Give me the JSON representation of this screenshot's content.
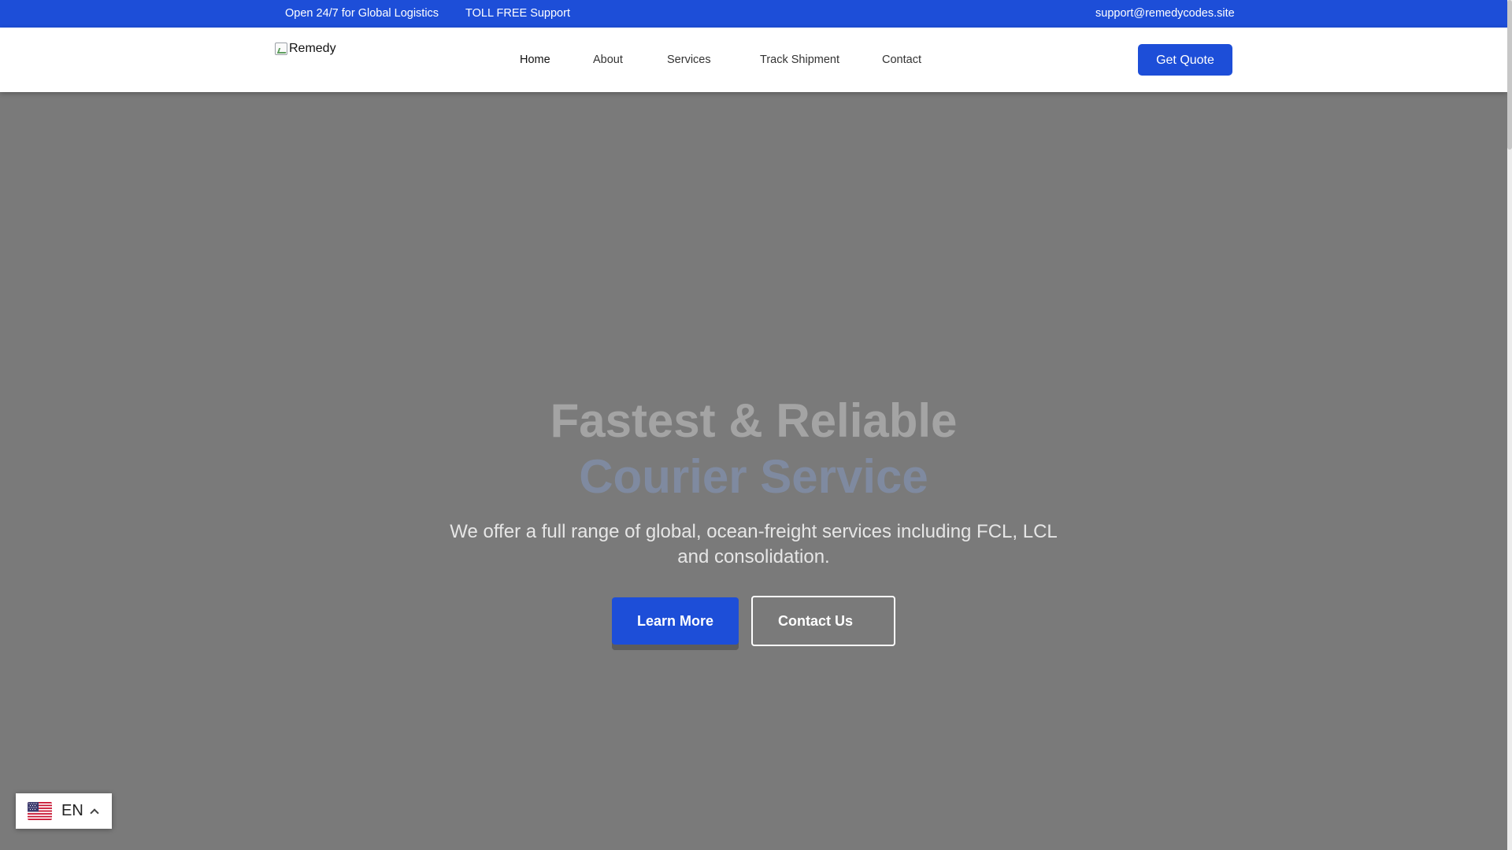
{
  "topbar": {
    "tagline": "Open 24/7 for Global Logistics",
    "support": "TOLL FREE Support",
    "email": "support@remedycodes.site"
  },
  "header": {
    "logo_alt": "Remedy",
    "nav": {
      "home": "Home",
      "about": "About",
      "services": "Services",
      "track": "Track Shipment",
      "contact": "Contact"
    },
    "cta": "Get Quote"
  },
  "hero": {
    "title_line1": "Fastest & Reliable",
    "title_line2": "Courier Service",
    "subtitle": "We offer a full range of global, ocean-freight services including FCL, LCL and consolidation.",
    "primary_button": "Learn More",
    "secondary_button": "Contact Us"
  },
  "language": {
    "code": "EN",
    "flag_icon": "us-flag-icon"
  },
  "colors": {
    "brand_blue": "#1d4ed8",
    "hero_overlay": "#7a7a7a"
  }
}
